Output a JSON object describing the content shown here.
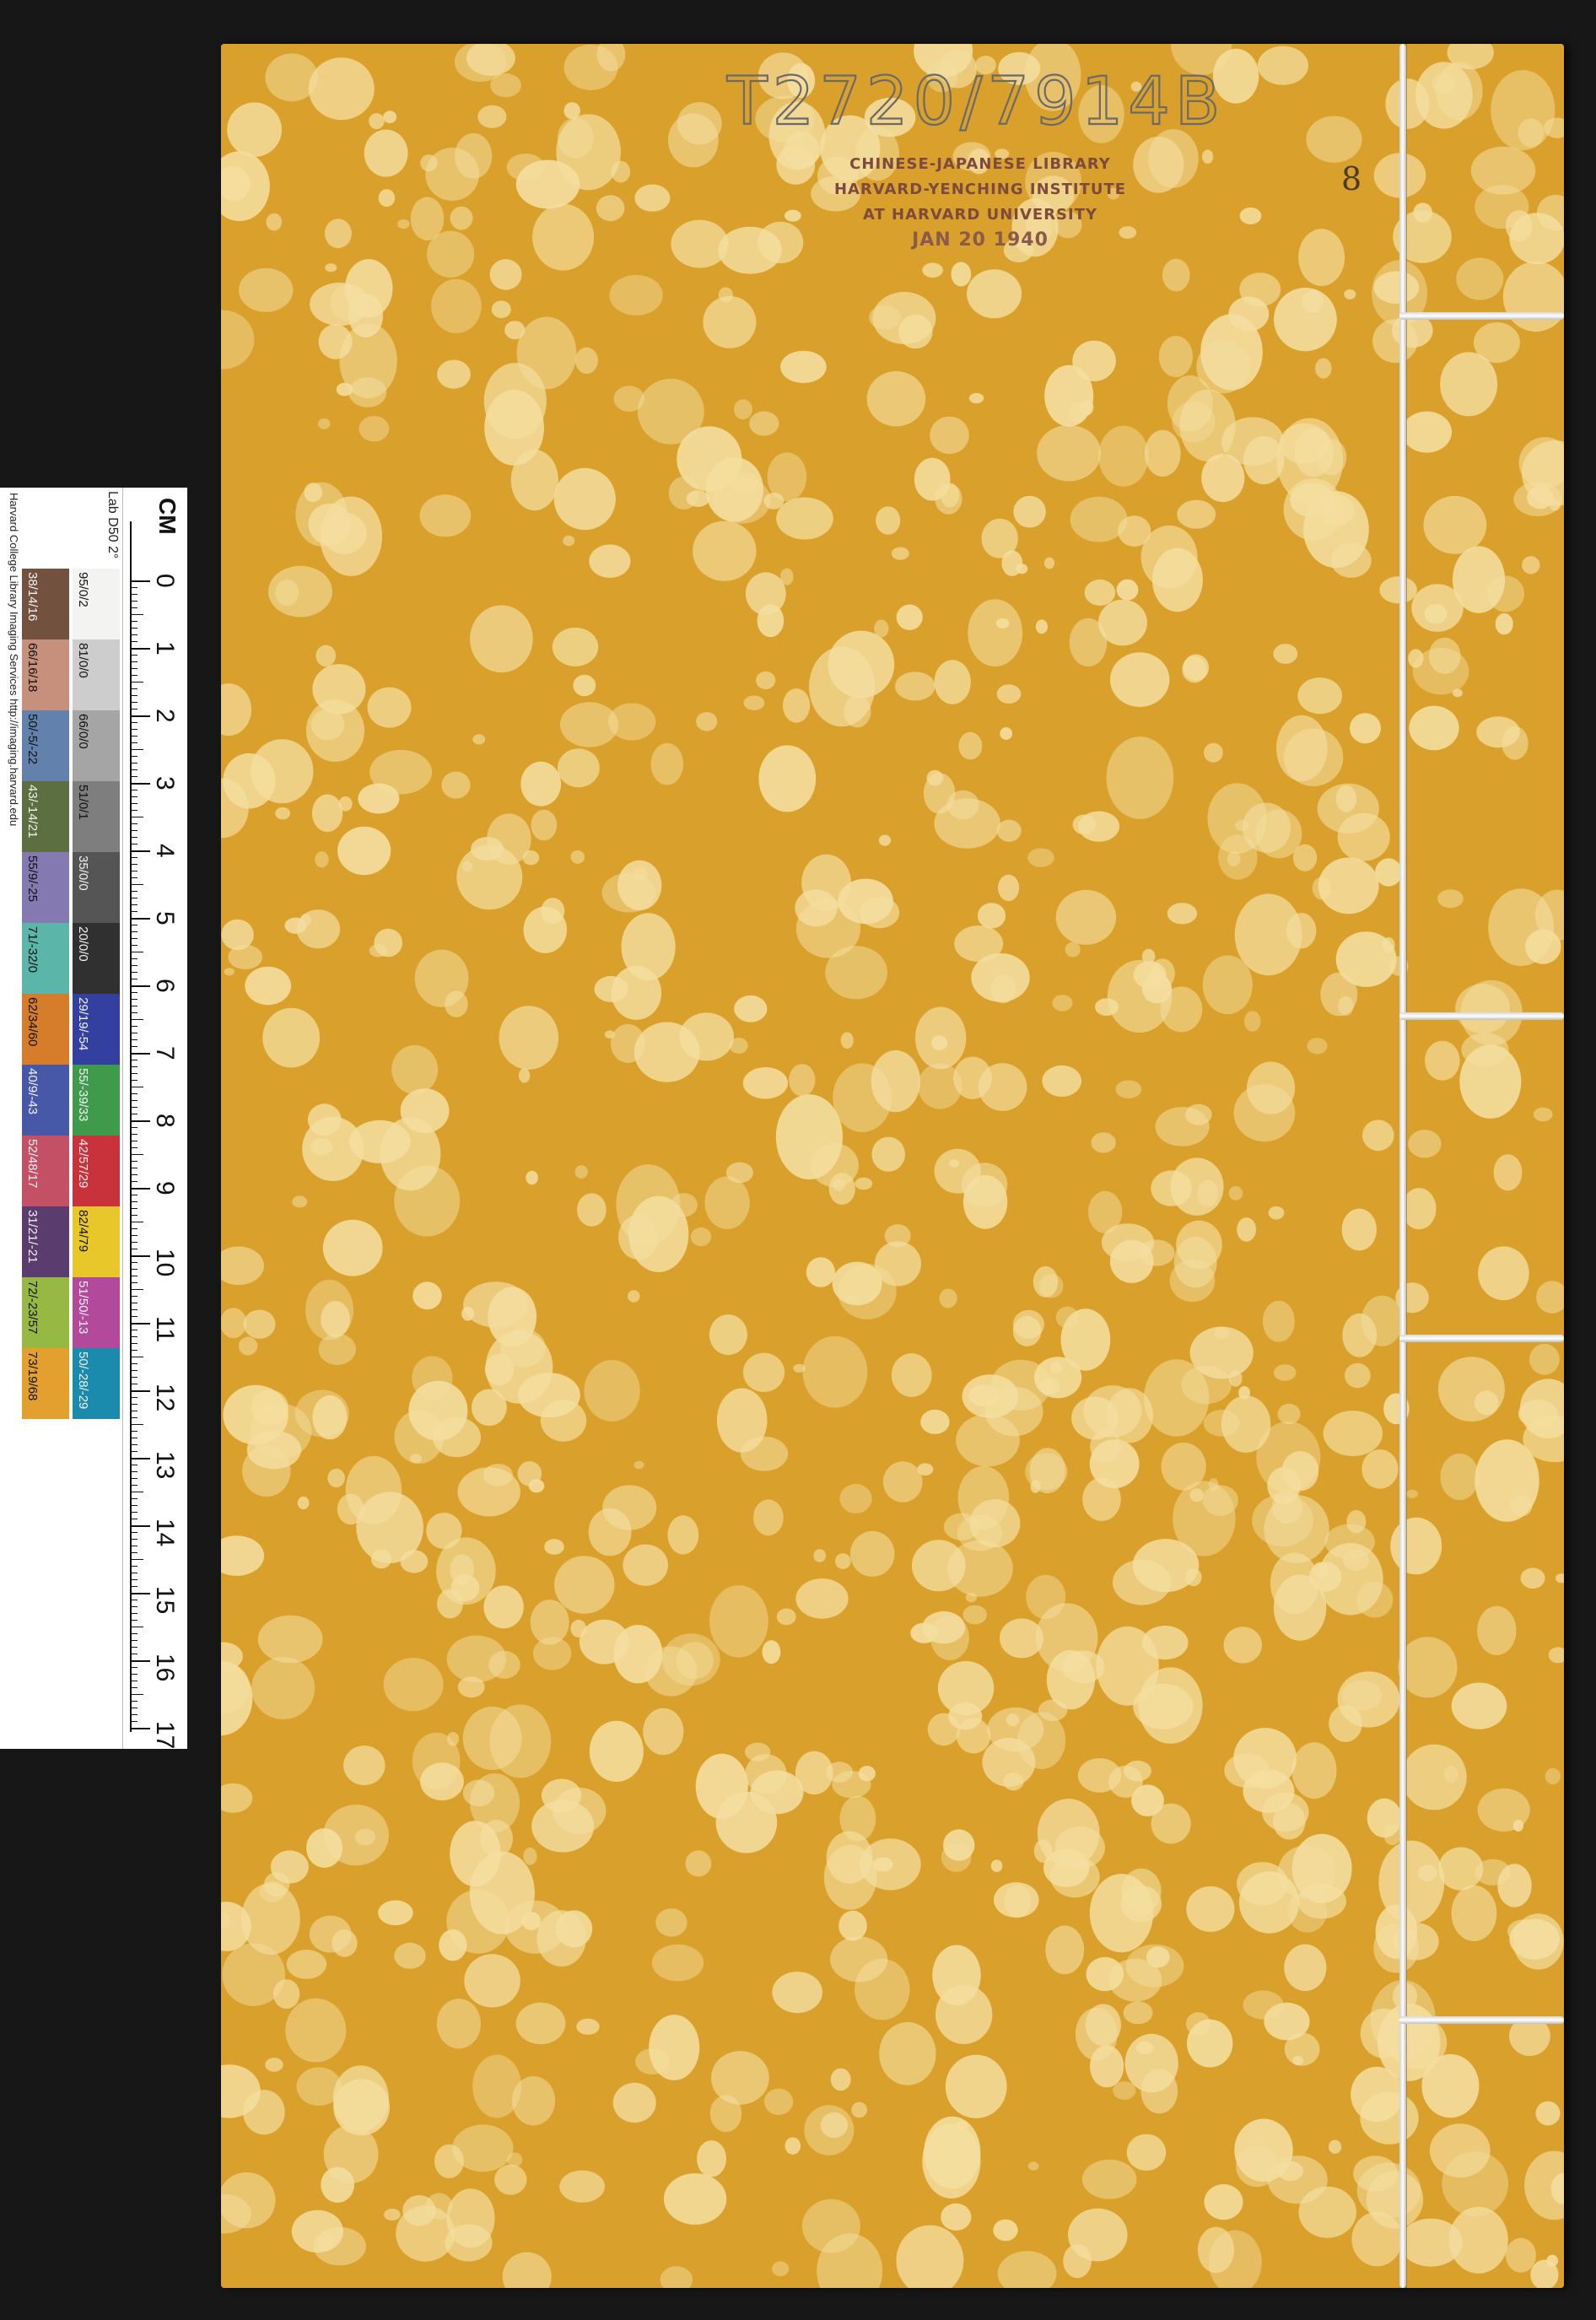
{
  "book": {
    "call_number": "T2720/7914B",
    "stamp_lines": [
      "CHINESE-JAPANESE LIBRARY",
      "HARVARD-YENCHING INSTITUTE",
      "AT HARVARD UNIVERSITY"
    ],
    "stamp_date": "JAN 20 1940",
    "volume_number": "8",
    "cover_color": "#d9a12b",
    "spot_color": "#f4dea0",
    "thread_color": "#f2f2f2"
  },
  "color_card": {
    "unit": "CM",
    "ruler_labels": [
      "0",
      "1",
      "2",
      "3",
      "4",
      "5",
      "6",
      "7",
      "8",
      "9",
      "10",
      "11",
      "12",
      "13",
      "14",
      "15",
      "16",
      "17"
    ],
    "gray_row_label": "Lab D50 2°",
    "gray_row": [
      {
        "label": "95/0/2",
        "color": "#f3f3f1"
      },
      {
        "label": "81/0/0",
        "color": "#cdcdcd"
      },
      {
        "label": "66/0/0",
        "color": "#a5a5a5"
      },
      {
        "label": "51/0/1",
        "color": "#7e7e7e"
      },
      {
        "label": "35/0/0",
        "color": "#555555"
      },
      {
        "label": "20/0/0",
        "color": "#303030"
      },
      {
        "label": "29/19/-54",
        "color": "#3440a0"
      },
      {
        "label": "55/-39/33",
        "color": "#3f9a4c"
      },
      {
        "label": "42/57/29",
        "color": "#c9323a"
      },
      {
        "label": "82/4/79",
        "color": "#e8c72a"
      },
      {
        "label": "51/50/-13",
        "color": "#b3499a"
      },
      {
        "label": "50/-28/-29",
        "color": "#1a8aad"
      }
    ],
    "color_row": [
      {
        "label": "38/14/16",
        "color": "#73513f"
      },
      {
        "label": "66/16/18",
        "color": "#c6907c"
      },
      {
        "label": "50/-5/-22",
        "color": "#6281ac"
      },
      {
        "label": "43/-14/21",
        "color": "#5c6f40"
      },
      {
        "label": "55/9/-25",
        "color": "#8579b2"
      },
      {
        "label": "71/-32/0",
        "color": "#5bb6a9"
      },
      {
        "label": "62/34/60",
        "color": "#d67d2b"
      },
      {
        "label": "40/9/-43",
        "color": "#4758a8"
      },
      {
        "label": "52/48/17",
        "color": "#c35064"
      },
      {
        "label": "31/21/-21",
        "color": "#5b3c6e"
      },
      {
        "label": "72/-23/57",
        "color": "#97b944"
      },
      {
        "label": "73/19/68",
        "color": "#e3a02e"
      }
    ],
    "credit": "Harvard College Library Imaging Services http://imaging.harvard.edu"
  }
}
